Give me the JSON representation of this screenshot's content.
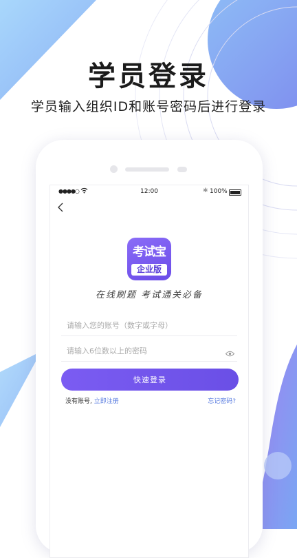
{
  "header": {
    "title": "学员登录",
    "subtitle": "学员输入组织ID和账号密码后进行登录"
  },
  "status_bar": {
    "signal": "●●●●○",
    "time": "12:00",
    "bluetooth": "✱",
    "battery": "100%"
  },
  "app": {
    "logo_text": "考试宝",
    "logo_badge": "企业版",
    "slogan": "在线刷题  考试通关必备"
  },
  "form": {
    "account_placeholder": "请输入您的账号（数字或字母）",
    "password_placeholder": "请输入6位数以上的密码",
    "login_label": "快速登录",
    "no_account_text": "没有账号,",
    "register_link": "立即注册",
    "forgot_link": "忘记密码?"
  },
  "colors": {
    "accent": "#6a4fe6",
    "link": "#5a7de0",
    "bg_blue": "#8fc5f5",
    "bg_purple": "#8b8cf0"
  },
  "icons": {
    "back": "chevron-left-icon",
    "password_toggle": "eye-icon",
    "wifi": "wifi-icon"
  }
}
